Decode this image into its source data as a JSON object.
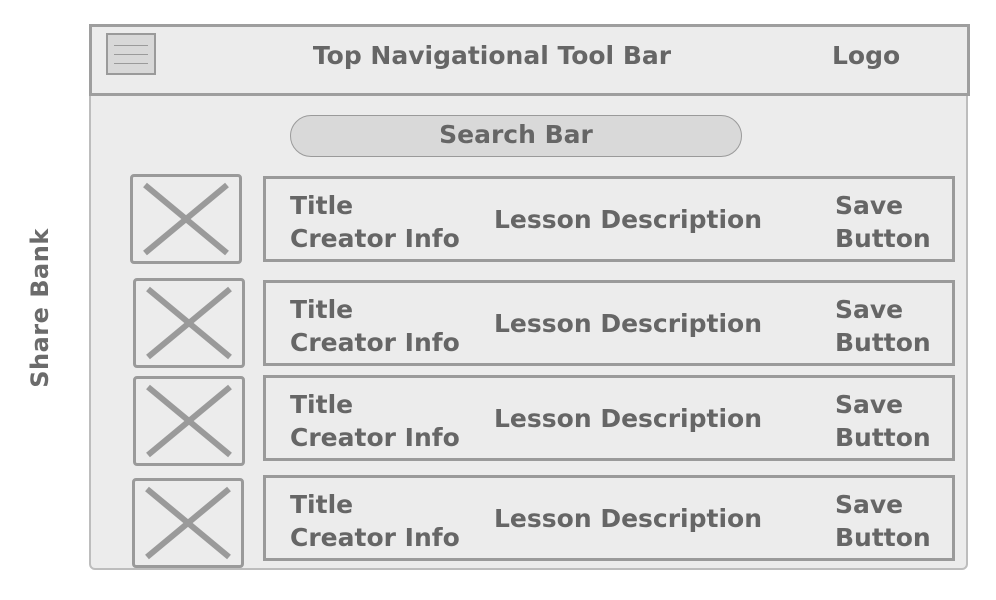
{
  "side_label": "Share Bank",
  "header": {
    "title": "Top Navigational Tool Bar",
    "logo": "Logo"
  },
  "search": {
    "label": "Search Bar"
  },
  "items": [
    {
      "title": "Title",
      "creator": "Creator Info",
      "description": "Lesson Description",
      "save_line1": "Save",
      "save_line2": "Button"
    },
    {
      "title": "Title",
      "creator": "Creator Info",
      "description": "Lesson Description",
      "save_line1": "Save",
      "save_line2": "Button"
    },
    {
      "title": "Title",
      "creator": "Creator Info",
      "description": "Lesson Description",
      "save_line1": "Save",
      "save_line2": "Button"
    },
    {
      "title": "Title",
      "creator": "Creator Info",
      "description": "Lesson Description",
      "save_line1": "Save",
      "save_line2": "Button"
    }
  ],
  "icons": {
    "menu": "hamburger-menu-icon",
    "thumbnail": "image-placeholder-icon"
  },
  "colors": {
    "frame_background": "#ececec",
    "stroke": "#9a9a9a",
    "text": "#666666",
    "search_fill": "#d9d9d9"
  }
}
